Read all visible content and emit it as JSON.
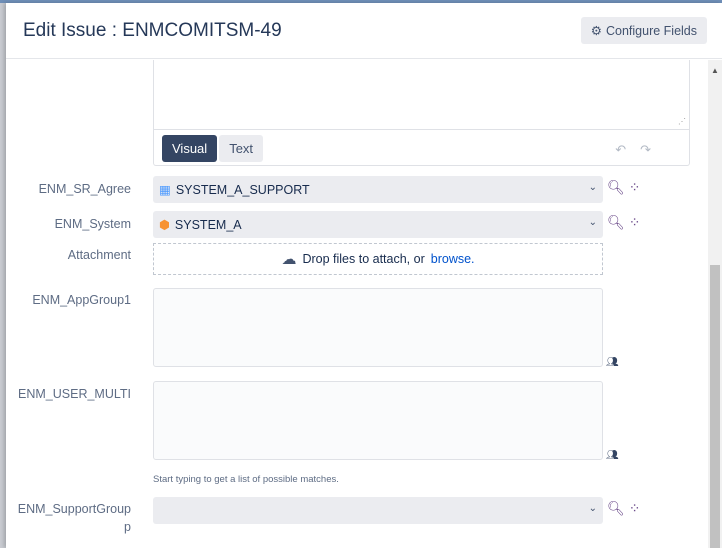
{
  "dialog": {
    "title": "Edit Issue : ENMCOMITSM-49",
    "configure_label": "Configure Fields"
  },
  "editor": {
    "tabs": [
      "Visual",
      "Text"
    ]
  },
  "fields": {
    "sr_agree": {
      "label": "ENM_SR_Agree",
      "value": "SYSTEM_A_SUPPORT"
    },
    "system": {
      "label": "ENM_System",
      "value": "SYSTEM_A"
    },
    "attachment": {
      "label": "Attachment",
      "text": "Drop files to attach, or",
      "link": "browse."
    },
    "appgroup": {
      "label": "ENM_AppGroup1"
    },
    "user_multi": {
      "label": "ENM_USER_MULTI",
      "hint": "Start typing to get a list of possible matches."
    },
    "support_group": {
      "label": "ENM_SupportGroup",
      "label2": "p"
    }
  }
}
